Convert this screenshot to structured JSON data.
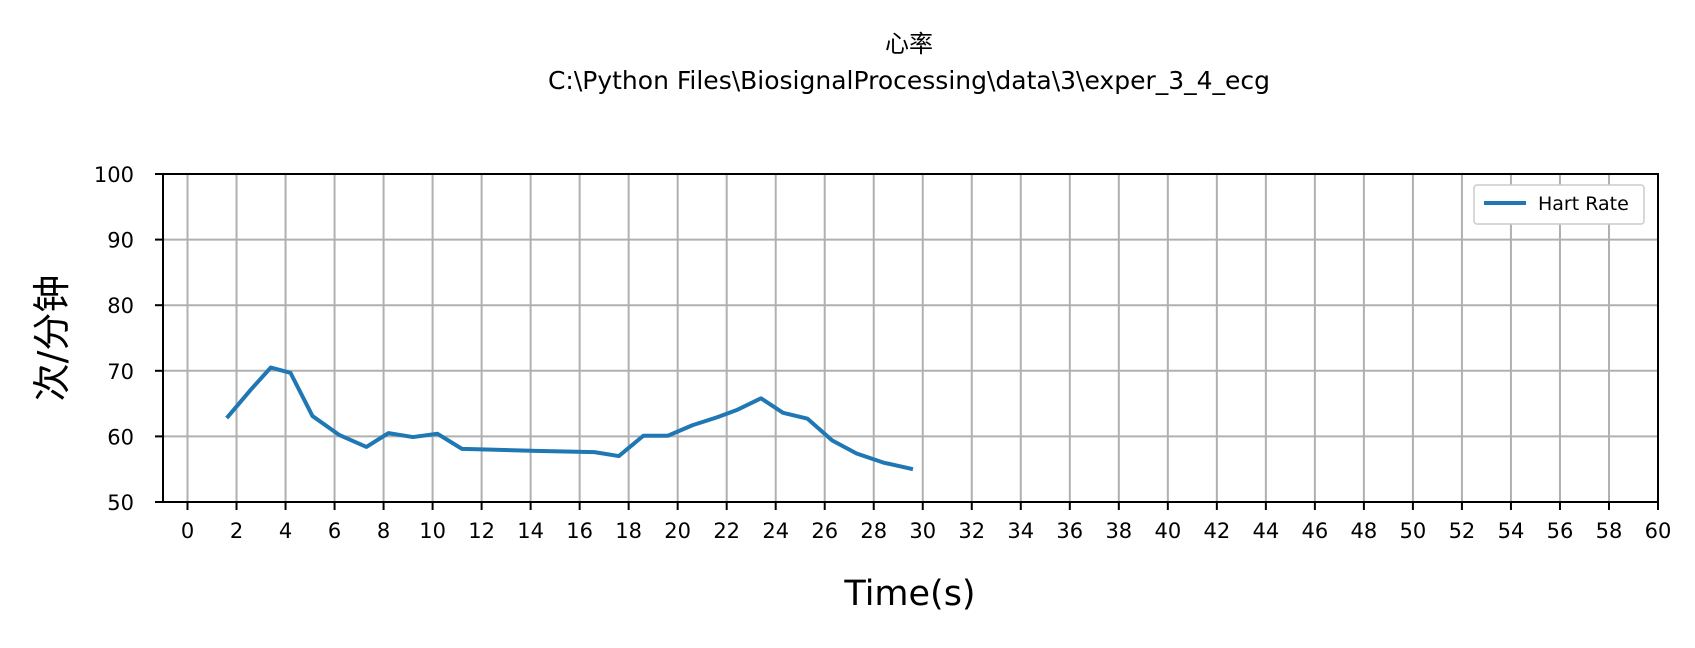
{
  "chart_data": {
    "type": "line",
    "title": "心率",
    "subtitle": "C:\\Python Files\\BiosignalProcessing\\data\\3\\exper_3_4_ecg",
    "xlabel": "Time(s)",
    "ylabel": "次/分钟",
    "xlim": [
      -1,
      60
    ],
    "ylim": [
      50,
      100
    ],
    "xticks": [
      0,
      2,
      4,
      6,
      8,
      10,
      12,
      14,
      16,
      18,
      20,
      22,
      24,
      26,
      28,
      30,
      32,
      34,
      36,
      38,
      40,
      42,
      44,
      46,
      48,
      50,
      52,
      54,
      56,
      58,
      60
    ],
    "yticks": [
      50,
      60,
      70,
      80,
      90,
      100
    ],
    "grid": true,
    "legend_position": "top-right",
    "series": [
      {
        "name": "Hart Rate",
        "color": "#1f77b4",
        "x": [
          1.6,
          2.6,
          3.4,
          4.2,
          5.1,
          6.2,
          7.3,
          8.2,
          9.2,
          10.2,
          11.2,
          12.2,
          14.2,
          16.6,
          17.6,
          18.6,
          19.6,
          20.6,
          21.6,
          22.4,
          23.4,
          24.3,
          25.3,
          26.3,
          27.3,
          28.4,
          29.6
        ],
        "y": [
          62.8,
          67.2,
          70.5,
          69.7,
          63.1,
          60.2,
          58.4,
          60.5,
          59.9,
          60.4,
          58.1,
          58.0,
          57.8,
          57.6,
          57.0,
          60.1,
          60.1,
          61.7,
          62.9,
          64.0,
          65.8,
          63.6,
          62.7,
          59.4,
          57.4,
          56.0,
          55.0
        ]
      }
    ]
  }
}
